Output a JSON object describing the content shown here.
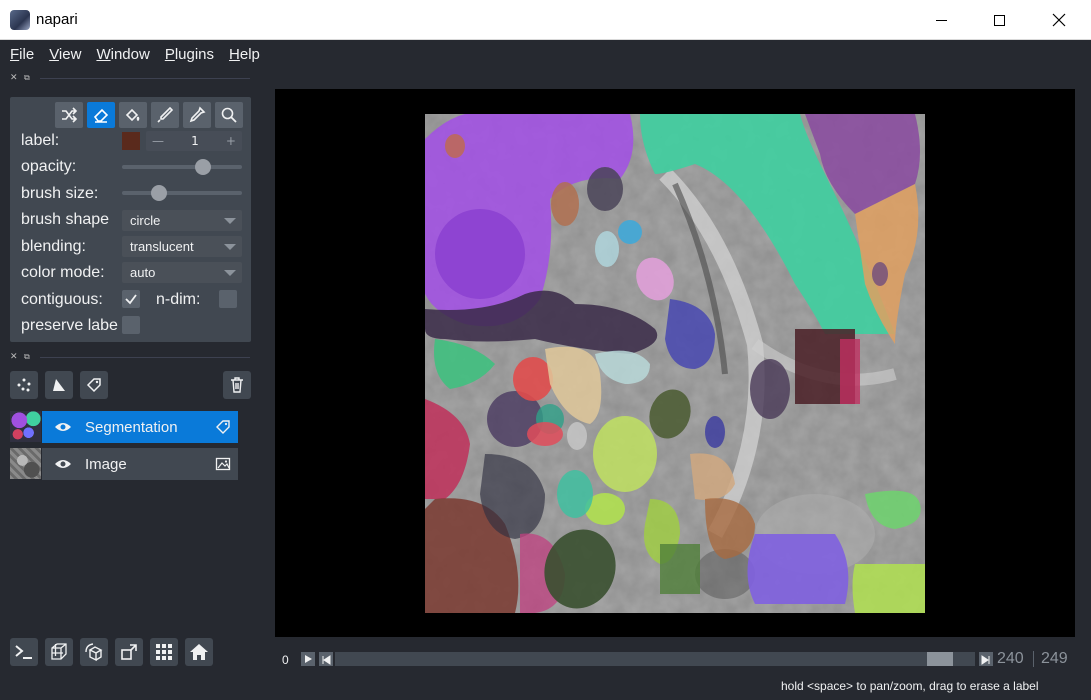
{
  "window": {
    "title": "napari"
  },
  "menu": [
    {
      "first": "F",
      "rest": "ile"
    },
    {
      "first": "V",
      "rest": "iew"
    },
    {
      "first": "W",
      "rest": "indow"
    },
    {
      "first": "P",
      "rest": "lugins"
    },
    {
      "first": "H",
      "rest": "elp"
    }
  ],
  "layer_controls": {
    "tools": [
      "shuffle-icon",
      "eraser-icon",
      "fill-icon",
      "paintbrush-icon",
      "picker-icon",
      "zoom-icon"
    ],
    "active_tool": "eraser-icon",
    "label": {
      "text": "label:",
      "value": "1",
      "color": "#5a2a1c"
    },
    "opacity": {
      "text": "opacity:",
      "level": 0.7
    },
    "brush_size": {
      "text": "brush size:",
      "level": 0.28
    },
    "brush_shape": {
      "text": "brush shape",
      "value": "circle"
    },
    "blending": {
      "text": "blending:",
      "value": "translucent"
    },
    "color_mode": {
      "text": "color mode:",
      "value": "auto"
    },
    "contiguous": {
      "text": "contiguous:",
      "checked": true
    },
    "n_dim": {
      "text": "n-dim:",
      "checked": false
    },
    "preserve_labels": {
      "text": "preserve labe",
      "checked": false
    }
  },
  "layer_list_buttons": [
    "new-points-icon",
    "new-shapes-icon",
    "new-labels-icon",
    "delete-icon"
  ],
  "layers": [
    {
      "name": "Segmentation",
      "selected": true,
      "type_icon": "label-tag-icon"
    },
    {
      "name": "Image",
      "selected": false,
      "type_icon": "image-icon"
    }
  ],
  "viewer_buttons": [
    "console-icon",
    "ndisplay-icon",
    "roll-icon",
    "transpose-icon",
    "grid-icon",
    "home-icon"
  ],
  "dims": {
    "start": "0",
    "current": "240",
    "max": "249",
    "position": 0.964
  },
  "status": "hold <space> to pan/zoom, drag to erase a label",
  "accent_color": "#0a7ad9"
}
